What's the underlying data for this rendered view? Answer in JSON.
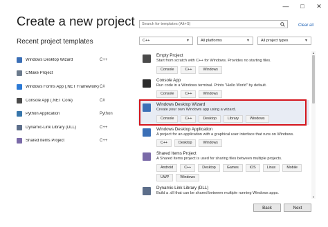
{
  "window": {
    "controls": [
      "—",
      "□",
      "✕"
    ]
  },
  "title": "Create a new project",
  "recent": {
    "heading": "Recent project templates",
    "items": [
      {
        "name": "Windows Desktop Wizard",
        "lang": "C++",
        "icon": "windows-desktop-icon",
        "color": "#3b6fb6"
      },
      {
        "name": "CMake Project",
        "lang": "",
        "icon": "cmake-icon",
        "color": "#6b7a8c"
      },
      {
        "name": "Windows Forms App (.NET Framework)",
        "lang": "C#",
        "icon": "windows-forms-icon",
        "color": "#2c7ad6"
      },
      {
        "name": "Console App (.NET Core)",
        "lang": "C#",
        "icon": "console-icon",
        "color": "#4a4a4a"
      },
      {
        "name": "Python Application",
        "lang": "Python",
        "icon": "python-icon",
        "color": "#3776ab"
      },
      {
        "name": "Dynamic-Link Library (DLL)",
        "lang": "C++",
        "icon": "dll-icon",
        "color": "#5c6e8a"
      },
      {
        "name": "Shared Items Project",
        "lang": "C++",
        "icon": "shared-items-icon",
        "color": "#7a6aa8"
      }
    ]
  },
  "search": {
    "placeholder": "Search for templates (Alt+S)",
    "clear_all": "Clear all"
  },
  "filters": {
    "language": "C++",
    "platform": "All platforms",
    "project_type": "All project types"
  },
  "templates": [
    {
      "name": "Empty Project",
      "desc": "Start from scratch with C++ for Windows. Provides no starting files.",
      "tags": [
        "Console",
        "C++",
        "Windows"
      ],
      "icon": "empty-project-icon",
      "color": "#4a4a4a",
      "selected": false
    },
    {
      "name": "Console App",
      "desc": "Run code in a Windows terminal. Prints \"Hello World\" by default.",
      "tags": [
        "Console",
        "C++",
        "Windows"
      ],
      "icon": "console-app-icon",
      "color": "#2b2b2b",
      "selected": false
    },
    {
      "name": "Windows Desktop Wizard",
      "desc": "Create your own Windows app using a wizard.",
      "tags": [
        "Console",
        "C++",
        "Desktop",
        "Library",
        "Windows"
      ],
      "icon": "windows-desktop-wizard-icon",
      "color": "#3b6fb6",
      "selected": true
    },
    {
      "name": "Windows Desktop Application",
      "desc": "A project for an application with a graphical user interface that runs on Windows.",
      "tags": [
        "C++",
        "Desktop",
        "Windows"
      ],
      "icon": "windows-desktop-application-icon",
      "color": "#3b6fb6",
      "selected": false
    },
    {
      "name": "Shared Items Project",
      "desc": "A Shared Items project is used for sharing files between multiple projects.",
      "tags": [
        "Android",
        "C++",
        "Desktop",
        "Games",
        "iOS",
        "Linux",
        "Mobile",
        "UWP",
        "Windows"
      ],
      "icon": "shared-items-project-icon",
      "color": "#7a6aa8",
      "selected": false
    },
    {
      "name": "Dynamic-Link Library (DLL)",
      "desc": "Build a .dll that can be shared between multiple running Windows apps.",
      "tags": [],
      "icon": "dll-project-icon",
      "color": "#5c6e8a",
      "selected": false
    }
  ],
  "buttons": {
    "back": "Back",
    "next": "Next"
  }
}
